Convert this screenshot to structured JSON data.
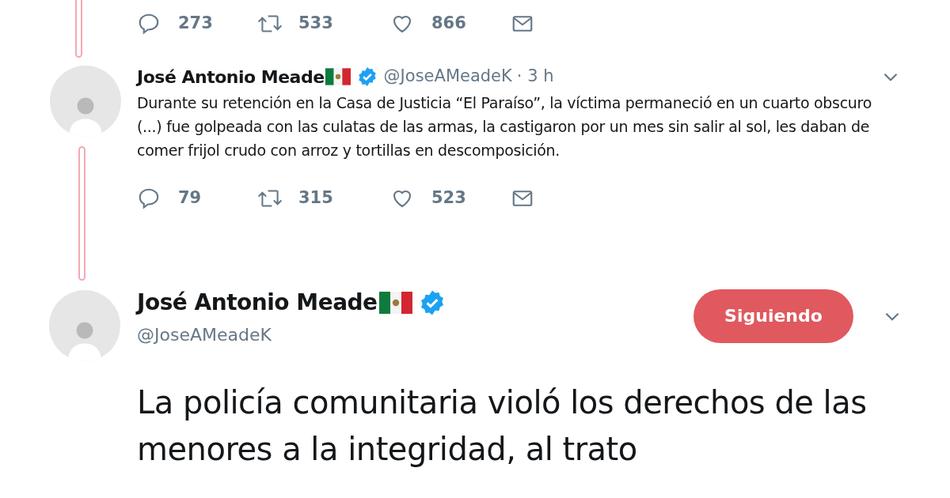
{
  "previous_tweet": {
    "actions": {
      "replies": "273",
      "retweets": "533",
      "likes": "866"
    }
  },
  "thread_tweet": {
    "name": "José Antonio Meade",
    "handle": "@JoseAMeadeK",
    "time": "· 3 h",
    "text": "Durante su retención en la Casa de Justicia “El Paraíso”, la víctima permaneció en un cuarto obscuro (...) fue golpeada con las culatas de las armas, la castigaron por un mes sin salir al sol, les daban de comer frijol crudo con arroz y tortillas en descomposición.",
    "actions": {
      "replies": "79",
      "retweets": "315",
      "likes": "523"
    }
  },
  "main_tweet": {
    "name": "José Antonio Meade",
    "handle": "@JoseAMeadeK",
    "follow_button": "Siguiendo",
    "text": "La policía comunitaria violó los derechos de las menores a la integridad, al trato"
  }
}
